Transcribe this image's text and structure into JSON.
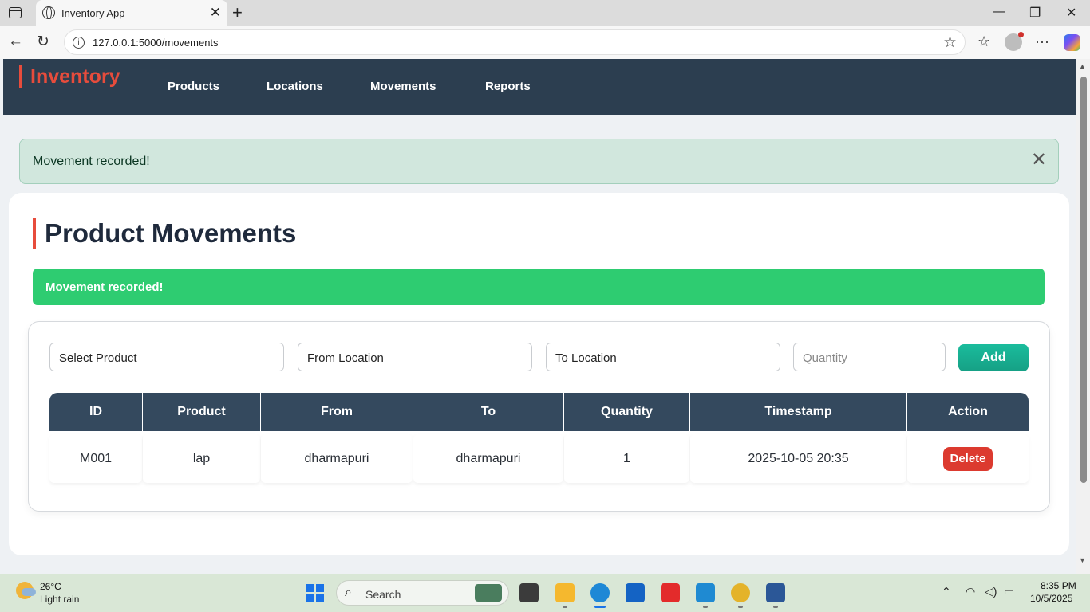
{
  "browser": {
    "tab_title": "Inventory App",
    "url": "127.0.0.1:5000/movements"
  },
  "nav": {
    "brand": "Inventory",
    "links": [
      "Products",
      "Locations",
      "Movements",
      "Reports"
    ]
  },
  "alert": {
    "message": "Movement recorded!"
  },
  "page": {
    "title": "Product Movements",
    "success_message": "Movement recorded!"
  },
  "form": {
    "product_select": "Select Product",
    "from_select": "From Location",
    "to_select": "To Location",
    "quantity_placeholder": "Quantity",
    "add_label": "Add"
  },
  "table": {
    "headers": [
      "ID",
      "Product",
      "From",
      "To",
      "Quantity",
      "Timestamp",
      "Action"
    ],
    "rows": [
      {
        "id": "M001",
        "product": "lap",
        "from": "dharmapuri",
        "to": "dharmapuri",
        "quantity": "1",
        "timestamp": "2025-10-05 20:35",
        "action": "Delete"
      }
    ]
  },
  "taskbar": {
    "weather_temp": "26°C",
    "weather_desc": "Light rain",
    "search_label": "Search",
    "time": "8:35 PM",
    "date": "10/5/2025"
  },
  "colors": {
    "nav_bg": "#2c3e50",
    "brand_accent": "#e74c3c",
    "success": "#2ecc71",
    "add_button": "#16a085",
    "table_header": "#34495e",
    "delete_button": "#dc3a2f"
  }
}
